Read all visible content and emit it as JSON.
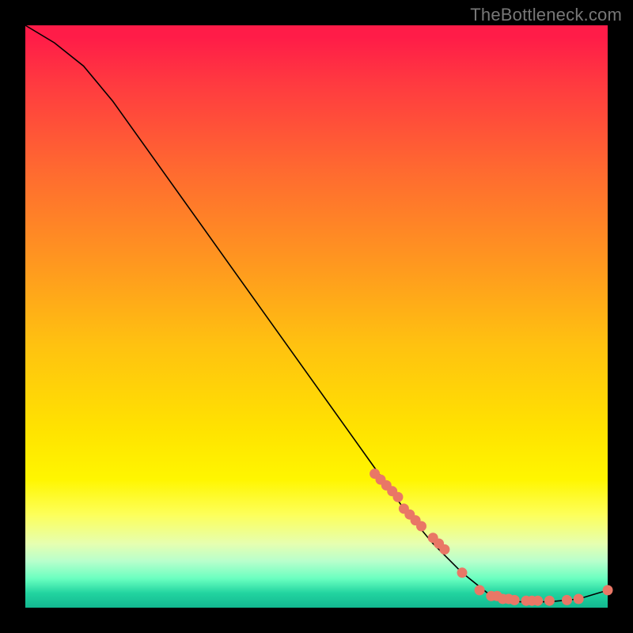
{
  "watermark": "TheBottleneck.com",
  "chart_data": {
    "type": "line",
    "title": "",
    "xlabel": "",
    "ylabel": "",
    "xlim": [
      0,
      100
    ],
    "ylim": [
      0,
      100
    ],
    "series": [
      {
        "name": "curve",
        "x": [
          0,
          5,
          10,
          15,
          20,
          25,
          30,
          35,
          40,
          45,
          50,
          55,
          60,
          65,
          70,
          75,
          80,
          85,
          90,
          95,
          100
        ],
        "y": [
          100,
          97,
          93,
          87,
          80,
          73,
          66,
          59,
          52,
          45,
          38,
          31,
          24,
          17,
          11,
          6,
          2,
          1,
          1,
          1.5,
          3
        ]
      }
    ],
    "markers": {
      "name": "dots",
      "color": "#e97766",
      "x": [
        60,
        61,
        62,
        63,
        64,
        65,
        66,
        67,
        68,
        70,
        71,
        72,
        75,
        78,
        80,
        81,
        82,
        83,
        84,
        86,
        87,
        88,
        90,
        93,
        95,
        100
      ],
      "y": [
        23,
        22,
        21,
        20,
        19,
        17,
        16,
        15,
        14,
        12,
        11,
        10,
        6,
        3,
        2,
        2,
        1.5,
        1.5,
        1.3,
        1.2,
        1.2,
        1.2,
        1.2,
        1.3,
        1.5,
        3
      ]
    }
  }
}
